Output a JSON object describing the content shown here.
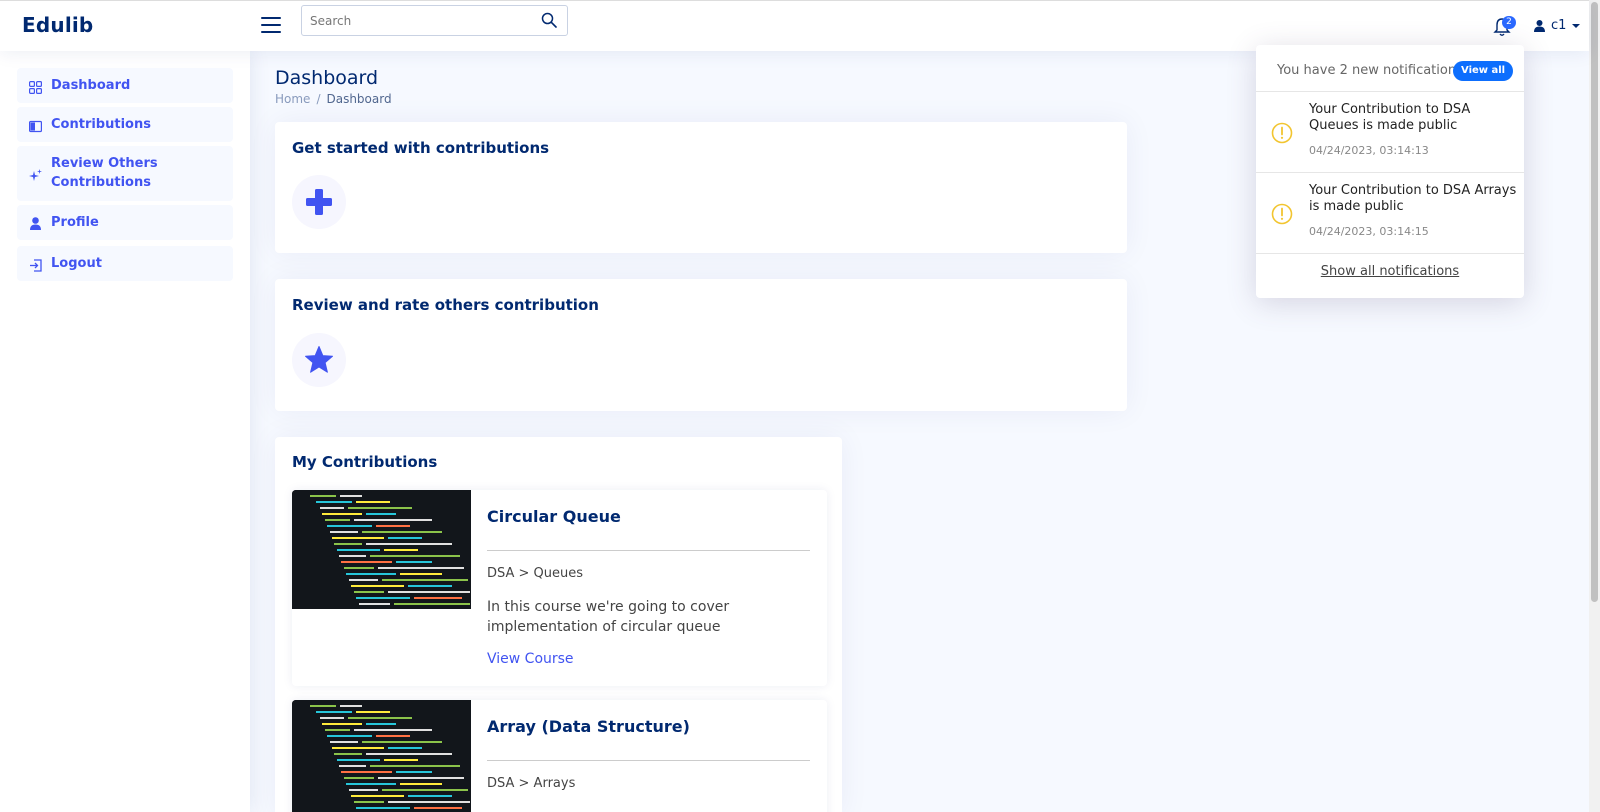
{
  "app": {
    "logo": "Edulib"
  },
  "header": {
    "search_placeholder": "Search",
    "notification_count": "2",
    "user_name": "c1"
  },
  "sidebar": {
    "items": [
      {
        "label": "Dashboard",
        "icon": "grid-icon"
      },
      {
        "label": "Contributions",
        "icon": "book-icon"
      },
      {
        "label": "Review Others Contributions",
        "icon": "sparkle-icon"
      },
      {
        "label": "Profile",
        "icon": "person-icon"
      },
      {
        "label": "Logout",
        "icon": "logout-icon"
      }
    ]
  },
  "main": {
    "page_title": "Dashboard",
    "breadcrumb": {
      "home": "Home",
      "separator": "/",
      "current": "Dashboard"
    },
    "get_started": {
      "title": "Get started with contributions",
      "icon": "plus-icon"
    },
    "review": {
      "title": "Review and rate others contribution",
      "icon": "star-icon"
    },
    "my_contributions": {
      "title": "My Contributions",
      "courses": [
        {
          "title": "Circular Queue",
          "path": "DSA > Queues",
          "description": "In this course we're going to cover implementation of circular queue",
          "link": "View Course"
        },
        {
          "title": "Array (Data Structure)",
          "path": "DSA > Arrays"
        }
      ]
    }
  },
  "notifications": {
    "header": "You have 2 new notifications",
    "view_all": "View all",
    "items": [
      {
        "text": "Your Contribution to DSA Queues is made public",
        "time": "04/24/2023, 03:14:13"
      },
      {
        "text": "Your Contribution to DSA Arrays is made public",
        "time": "04/24/2023, 03:14:15"
      }
    ],
    "show_all": "Show all notifications"
  },
  "colors": {
    "primary": "#4154f1",
    "heading": "#012970",
    "badge": "#0d6efd",
    "warning": "#f2c530",
    "background": "#f6f9ff"
  }
}
